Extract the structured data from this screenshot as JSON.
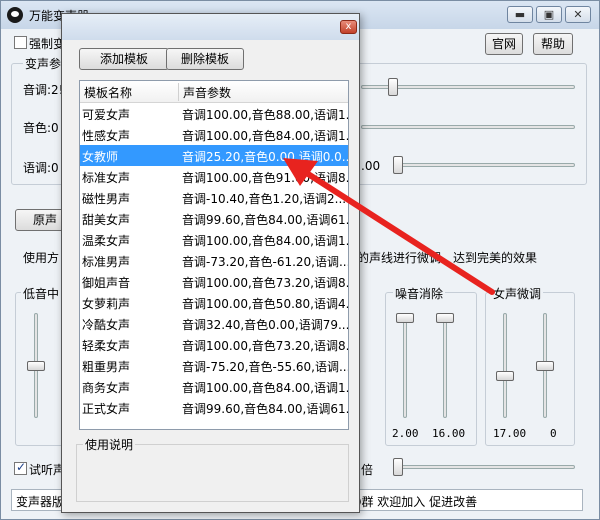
{
  "window": {
    "title": "万能变声器",
    "min_glyph": "▬",
    "max_glyph": "▣",
    "close_glyph": "✕"
  },
  "top": {
    "force_label": "强制变",
    "official_btn": "官网",
    "help_btn": "帮助"
  },
  "params_group": {
    "title": "变声参数",
    "pitch_label": "音调:2!",
    "timbre_label": "音色:0",
    "speed_label": "语调:0",
    "speed_value": ".00"
  },
  "original_btn": "原声",
  "usage_left": "使用方",
  "usage_right": "的声线进行微调，达到完美的效果",
  "bass_label": "低音中",
  "noise": {
    "title": "噪音消除",
    "val1": "2.00",
    "val2": "16.00"
  },
  "female": {
    "title": "女声微调",
    "val1": "17.00",
    "val2": "0"
  },
  "trial_label": "试听声",
  "times_label": "倍",
  "status_left": "变声器版",
  "status_right": "Q群 欢迎加入 促进改善",
  "dialog": {
    "close_glyph": "x",
    "add_btn": "添加模板",
    "delete_btn": "删除模板",
    "col_name": "模板名称",
    "col_param": "声音参数",
    "instructions_title": "使用说明",
    "rows": [
      {
        "name": "可爱女声",
        "param": "音调100.00,音色88.00,语调1..."
      },
      {
        "name": "性感女声",
        "param": "音调100.00,音色84.00,语调1..."
      },
      {
        "name": "女教师",
        "param": "音调25.20,音色0.00,语调0.0..."
      },
      {
        "name": "标准女声",
        "param": "音调100.00,音色91.00,语调8..."
      },
      {
        "name": "磁性男声",
        "param": "音调-10.40,音色1.20,语调2..."
      },
      {
        "name": "甜美女声",
        "param": "音调99.60,音色84.00,语调61..."
      },
      {
        "name": "温柔女声",
        "param": "音调100.00,音色84.00,语调1..."
      },
      {
        "name": "标准男声",
        "param": "音调-73.20,音色-61.20,语调..."
      },
      {
        "name": "御姐声音",
        "param": "音调100.00,音色73.20,语调8..."
      },
      {
        "name": "女萝莉声",
        "param": "音调100.00,音色50.80,语调4..."
      },
      {
        "name": "冷酷女声",
        "param": "音调32.40,音色0.00,语调79..."
      },
      {
        "name": "轻柔女声",
        "param": "音调100.00,音色73.20,语调8..."
      },
      {
        "name": "粗重男声",
        "param": "音调-75.20,音色-55.60,语调..."
      },
      {
        "name": "商务女声",
        "param": "音调100.00,音色84.00,语调1..."
      },
      {
        "name": "正式女声",
        "param": "音调99.60,音色84.00,语调61..."
      }
    ],
    "selected_index": 2
  },
  "colors": {
    "selection": "#3399ff",
    "arrow": "#e8231f"
  }
}
